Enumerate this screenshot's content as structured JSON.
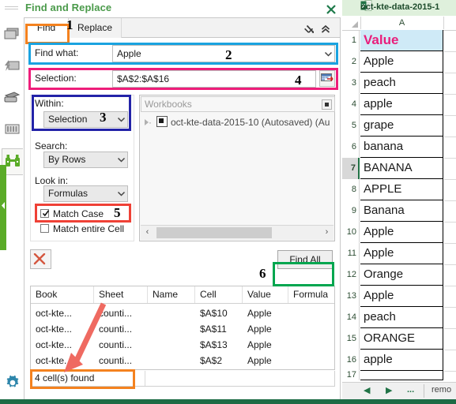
{
  "panel": {
    "title": "Find and Replace",
    "close_icon": "close-icon",
    "tabs": [
      {
        "label": "Find",
        "active": true
      },
      {
        "label": "Replace",
        "active": false
      }
    ],
    "header_icons": [
      "minimize-down-right-icon",
      "collapse-up-icon"
    ],
    "find_what": {
      "label": "Find what:",
      "value": "Apple",
      "placeholder": "",
      "dropdown_icon": "chevron-down-icon"
    },
    "selection": {
      "label": "Selection:",
      "value": "$A$2:$A$16",
      "picker_icon": "range-picker-icon"
    },
    "within": {
      "label": "Within:",
      "value": "Selection",
      "dropdown_icon": "chevron-down-icon"
    },
    "search": {
      "label": "Search:",
      "value": "By Rows",
      "dropdown_icon": "chevron-down-icon"
    },
    "look_in": {
      "label": "Look in:",
      "value": "Formulas",
      "dropdown_icon": "chevron-down-icon"
    },
    "match_case": {
      "label": "Match Case",
      "checked": true
    },
    "match_entire_cell": {
      "label": "Match entire Cell",
      "checked": false
    },
    "workbooks": {
      "header": "Workbooks",
      "header_button_icon": "square-icon",
      "items": [
        {
          "label": "oct-kte-data-2015-10 (Autosaved) (Au",
          "expand_icon": "triangle-right-icon",
          "node_icon": "workbook-node-icon"
        }
      ],
      "scroll_left_icon": "chevron-left-icon",
      "scroll_right_icon": "chevron-right-icon"
    },
    "clear_button": {
      "icon": "red-x-icon",
      "label": ""
    },
    "find_all_button": "Find All",
    "results": {
      "columns": [
        "Book",
        "Sheet",
        "Name",
        "Cell",
        "Value",
        "Formula"
      ],
      "rows": [
        {
          "book": "oct-kte...",
          "sheet": "counti...",
          "name": "",
          "cell": "$A$10",
          "value": "Apple",
          "formula": ""
        },
        {
          "book": "oct-kte...",
          "sheet": "counti...",
          "name": "",
          "cell": "$A$11",
          "value": "Apple",
          "formula": ""
        },
        {
          "book": "oct-kte...",
          "sheet": "counti...",
          "name": "",
          "cell": "$A$13",
          "value": "Apple",
          "formula": ""
        },
        {
          "book": "oct-kte...",
          "sheet": "counti...",
          "name": "",
          "cell": "$A$2",
          "value": "Apple",
          "formula": ""
        }
      ]
    },
    "status": "4 cell(s) found"
  },
  "rail": {
    "items": [
      {
        "icon": "windows-stack-icon",
        "active": false
      },
      {
        "icon": "flash-fill-icon",
        "active": false
      },
      {
        "icon": "printer-icon",
        "active": false
      },
      {
        "icon": "columns-icon",
        "active": false
      },
      {
        "icon": "binoculars-icon",
        "active": true
      }
    ],
    "settings_icon": "gear-icon"
  },
  "excel": {
    "title": "oct-kte-data-2015-1",
    "app_icon": "excel-icon",
    "column_header": "A",
    "rows": [
      {
        "num": "1",
        "value": "Value",
        "is_header": true,
        "selected": false
      },
      {
        "num": "2",
        "value": "Apple",
        "is_header": false,
        "selected": false
      },
      {
        "num": "3",
        "value": "peach",
        "is_header": false,
        "selected": false
      },
      {
        "num": "4",
        "value": "apple",
        "is_header": false,
        "selected": false
      },
      {
        "num": "5",
        "value": "grape",
        "is_header": false,
        "selected": false
      },
      {
        "num": "6",
        "value": "banana",
        "is_header": false,
        "selected": false
      },
      {
        "num": "7",
        "value": "BANANA",
        "is_header": false,
        "selected": true
      },
      {
        "num": "8",
        "value": "APPLE",
        "is_header": false,
        "selected": false
      },
      {
        "num": "9",
        "value": "Banana",
        "is_header": false,
        "selected": false
      },
      {
        "num": "10",
        "value": "Apple",
        "is_header": false,
        "selected": false
      },
      {
        "num": "11",
        "value": "Apple",
        "is_header": false,
        "selected": false
      },
      {
        "num": "12",
        "value": "Orange",
        "is_header": false,
        "selected": false
      },
      {
        "num": "13",
        "value": "Apple",
        "is_header": false,
        "selected": false
      },
      {
        "num": "14",
        "value": "peach",
        "is_header": false,
        "selected": false
      },
      {
        "num": "15",
        "value": "ORANGE",
        "is_header": false,
        "selected": false
      },
      {
        "num": "16",
        "value": "apple",
        "is_header": false,
        "selected": false
      },
      {
        "num": "17",
        "value": "",
        "is_header": false,
        "selected": false
      }
    ],
    "sheet_nav": {
      "prev_icon": "triangle-left-icon",
      "next_icon": "triangle-right-icon",
      "more_label": "...",
      "sheet_tab": "remo"
    }
  },
  "annotations": [
    {
      "number": "1",
      "color": "#f4821f",
      "target": "find-tab"
    },
    {
      "number": "2",
      "color": "#1aa3e0",
      "target": "find-what-row"
    },
    {
      "number": "3",
      "color": "#2323a8",
      "target": "within-group"
    },
    {
      "number": "4",
      "color": "#ee1d7a",
      "target": "selection-row"
    },
    {
      "number": "5",
      "color": "#ef4136",
      "target": "match-case-row"
    },
    {
      "number": "6",
      "color": "#00a64f",
      "target": "find-all-button"
    },
    {
      "number": "",
      "color": "#f4821f",
      "target": "status-bar"
    }
  ],
  "arrow": {
    "color": "#ef6a61",
    "points_to": "status-bar"
  }
}
